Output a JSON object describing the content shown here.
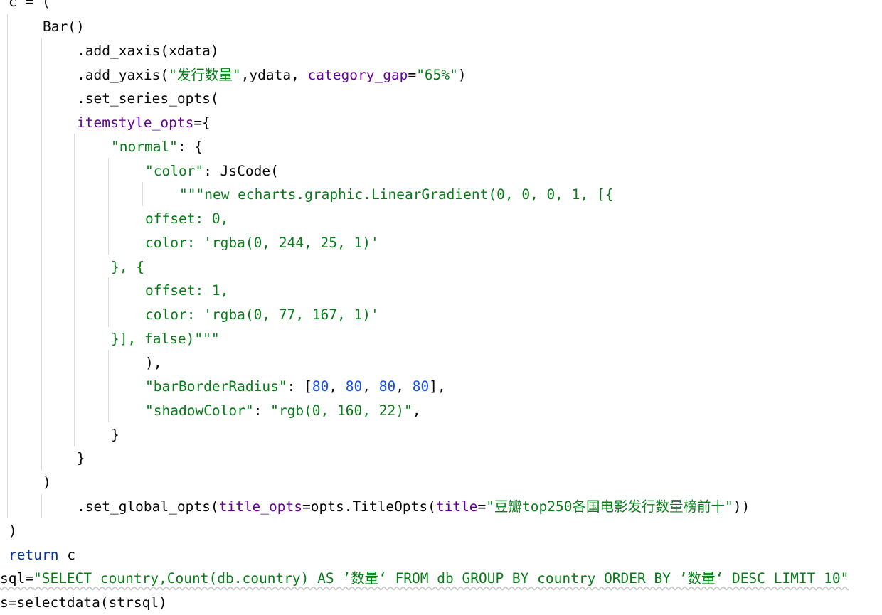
{
  "editor": {
    "lines": [
      [
        {
          "t": "c = (",
          "c": "def"
        }
      ],
      [
        {
          "t": "Bar()",
          "c": "def"
        }
      ],
      [
        {
          "t": ".add_xaxis(xdata)",
          "c": "def"
        }
      ],
      [
        {
          "t": ".add_yaxis(",
          "c": "def"
        },
        {
          "t": "\"发行数量\"",
          "c": "str"
        },
        {
          "t": ",ydata, ",
          "c": "def"
        },
        {
          "t": "category_gap",
          "c": "param"
        },
        {
          "t": "=",
          "c": "def"
        },
        {
          "t": "\"65%\"",
          "c": "str"
        },
        {
          "t": ")",
          "c": "def"
        }
      ],
      [
        {
          "t": ".set_series_opts(",
          "c": "def"
        }
      ],
      [
        {
          "t": "itemstyle_opts",
          "c": "param"
        },
        {
          "t": "={",
          "c": "def"
        }
      ],
      [
        {
          "t": "\"normal\"",
          "c": "str"
        },
        {
          "t": ": {",
          "c": "def"
        }
      ],
      [
        {
          "t": "\"color\"",
          "c": "str"
        },
        {
          "t": ": JsCode(",
          "c": "def"
        }
      ],
      [
        {
          "t": "\"\"\"new echarts.graphic.LinearGradient(0, 0, 0, 1, [{",
          "c": "str"
        }
      ],
      [
        {
          "t": "offset: 0,",
          "c": "str"
        }
      ],
      [
        {
          "t": "color: 'rgba(0, 244, 25, 1)'",
          "c": "str"
        }
      ],
      [
        {
          "t": "}, {",
          "c": "str"
        }
      ],
      [
        {
          "t": "offset: 1,",
          "c": "str"
        }
      ],
      [
        {
          "t": "color: 'rgba(0, 77, 167, 1)'",
          "c": "str"
        }
      ],
      [
        {
          "t": "}], false)\"\"\"",
          "c": "str"
        }
      ],
      [
        {
          "t": "),",
          "c": "def"
        }
      ],
      [
        {
          "t": "\"barBorderRadius\"",
          "c": "str"
        },
        {
          "t": ": [",
          "c": "def"
        },
        {
          "t": "80",
          "c": "num"
        },
        {
          "t": ", ",
          "c": "def"
        },
        {
          "t": "80",
          "c": "num"
        },
        {
          "t": ", ",
          "c": "def"
        },
        {
          "t": "80",
          "c": "num"
        },
        {
          "t": ", ",
          "c": "def"
        },
        {
          "t": "80",
          "c": "num"
        },
        {
          "t": "],",
          "c": "def"
        }
      ],
      [
        {
          "t": "\"shadowColor\"",
          "c": "str"
        },
        {
          "t": ": ",
          "c": "def"
        },
        {
          "t": "\"rgb(0, 160, 22)\"",
          "c": "str"
        },
        {
          "t": ",",
          "c": "def"
        }
      ],
      [
        {
          "t": "}",
          "c": "def"
        }
      ],
      [
        {
          "t": "}",
          "c": "def"
        }
      ],
      [
        {
          "t": ")",
          "c": "def"
        }
      ],
      [
        {
          "t": ".set_global_opts(",
          "c": "def"
        },
        {
          "t": "title_opts",
          "c": "param"
        },
        {
          "t": "=opts.TitleOpts(",
          "c": "def"
        },
        {
          "t": "title",
          "c": "param"
        },
        {
          "t": "=",
          "c": "def"
        },
        {
          "t": "\"豆瓣top250各国电影发行数量榜前十\"",
          "c": "str"
        },
        {
          "t": "))",
          "c": "def"
        }
      ],
      [
        {
          "t": ")",
          "c": "def"
        }
      ],
      [
        {
          "t": "return",
          "c": "kw"
        },
        {
          "t": " c",
          "c": "def"
        }
      ],
      [
        {
          "t": "sql=",
          "c": "def"
        },
        {
          "t": "\"SELECT country,Count(db.country) AS ’数量‘ FROM db GROUP BY country ORDER BY ’数量‘ DESC LIMIT 10\"",
          "c": "str"
        }
      ],
      [
        {
          "t": "s=selectdata(strsql)",
          "c": "def"
        }
      ]
    ]
  },
  "colors": {
    "default": "#080808",
    "string": "#067d17",
    "keyword": "#0033b3",
    "parameter": "#660099",
    "number": "#1750eb",
    "indent_guide": "#dcdcdc"
  }
}
